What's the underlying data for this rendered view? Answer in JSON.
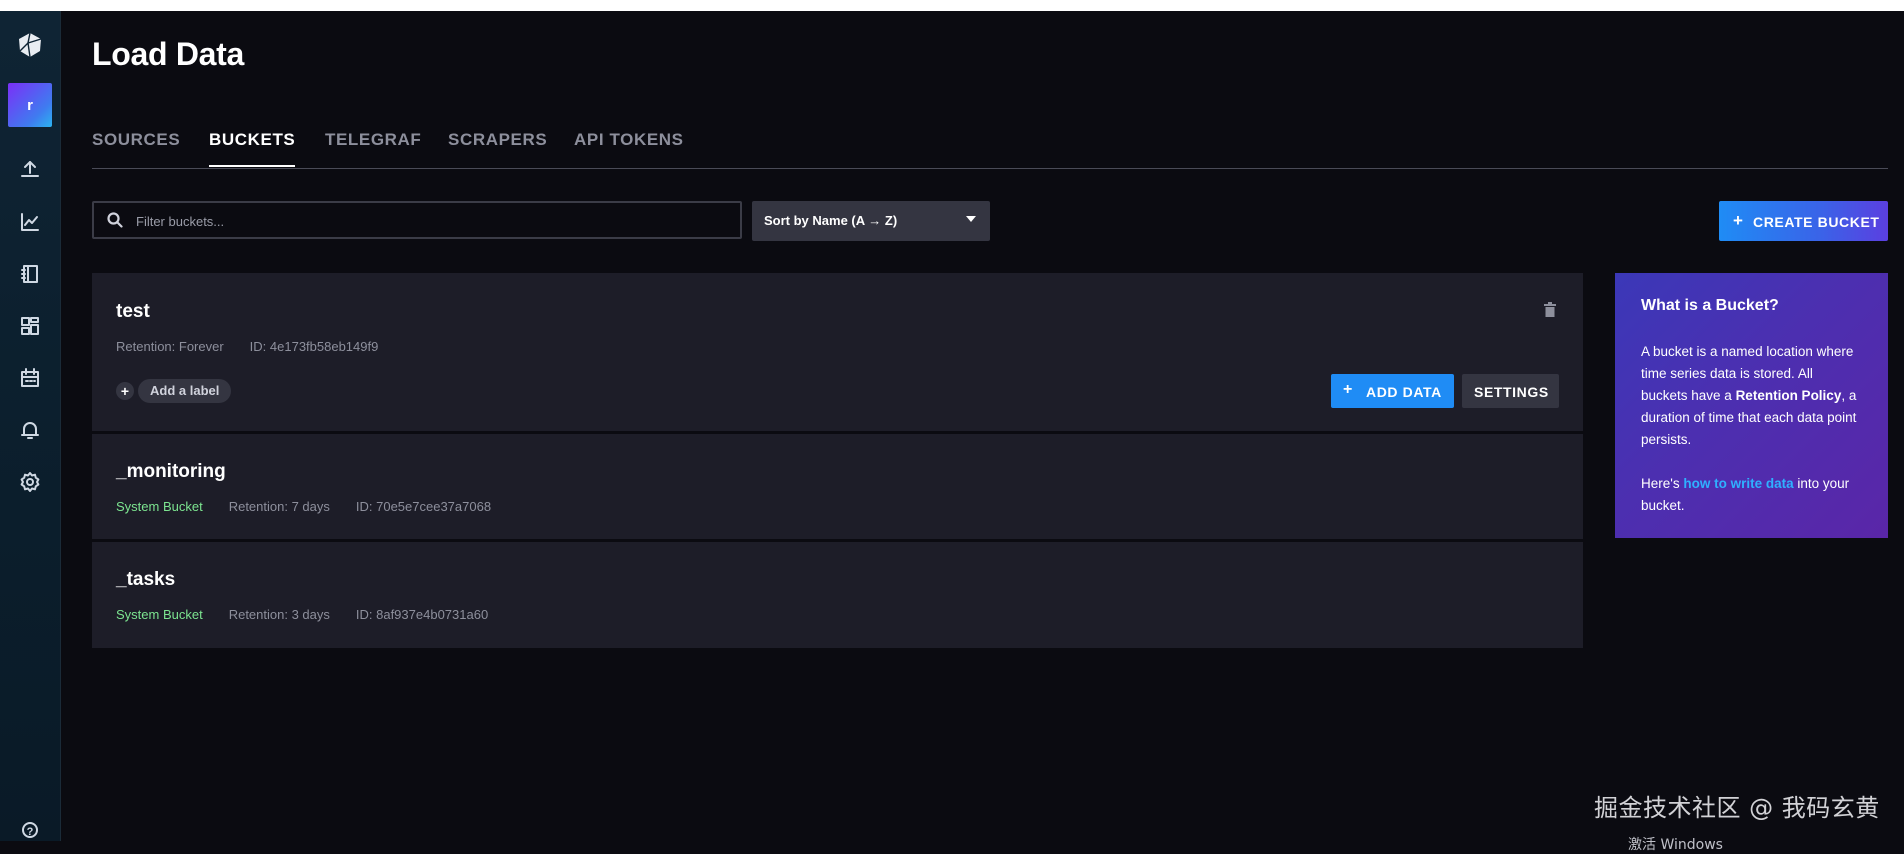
{
  "sidebar": {
    "avatar_initial": "r",
    "icons": [
      "logo-icon",
      "upload-icon",
      "chart-icon",
      "notebook-icon",
      "dashboards-icon",
      "calendar-icon",
      "bell-icon",
      "gear-icon",
      "help-icon"
    ]
  },
  "page": {
    "title": "Load Data"
  },
  "tabs": [
    {
      "label": "SOURCES",
      "active": false
    },
    {
      "label": "BUCKETS",
      "active": true
    },
    {
      "label": "TELEGRAF",
      "active": false
    },
    {
      "label": "SCRAPERS",
      "active": false
    },
    {
      "label": "API TOKENS",
      "active": false
    }
  ],
  "toolbar": {
    "search_placeholder": "Filter buckets...",
    "sort_label": "Sort by Name (A → Z)",
    "create_label": "CREATE BUCKET",
    "plus": "+"
  },
  "buckets": [
    {
      "name": "test",
      "retention": "Retention: Forever",
      "id": "ID: 4e173fb58eb149f9",
      "add_label": "Add a label",
      "add_data": "ADD DATA",
      "settings": "SETTINGS"
    },
    {
      "name": "_monitoring",
      "system": "System Bucket",
      "retention": "Retention: 7 days",
      "id": "ID: 70e5e7cee37a7068"
    },
    {
      "name": "_tasks",
      "system": "System Bucket",
      "retention": "Retention: 3 days",
      "id": "ID: 8af937e4b0731a60"
    }
  ],
  "info": {
    "title": "What is a Bucket?",
    "p1_a": "A bucket is a named location where time series data is stored. All buckets have a ",
    "p1_b": "Retention Policy",
    "p1_c": ", a duration of time that each data point persists.",
    "p2_a": "Here's ",
    "p2_link": "how to write data",
    "p2_c": " into your bucket."
  },
  "watermark": {
    "text": "掘金技术社区 @ 我码玄黄",
    "fragment": "激活 Windows"
  },
  "colors": {
    "accent": "#1f8cf5",
    "system_bucket": "#7ce490",
    "info_gradient_start": "#3b38b8",
    "info_gradient_end": "#5a26a8"
  }
}
